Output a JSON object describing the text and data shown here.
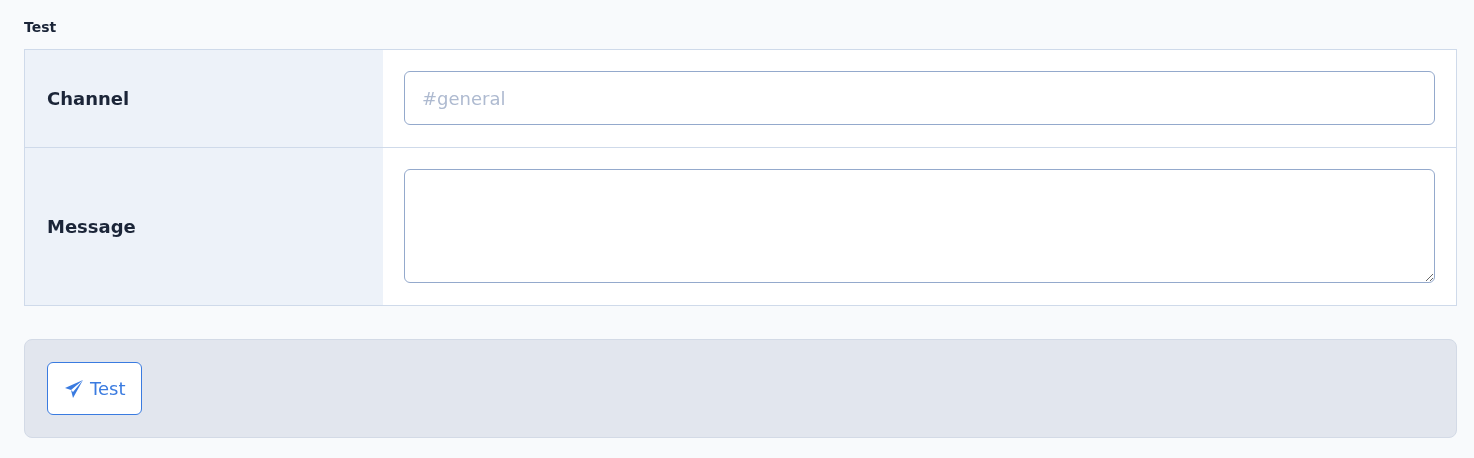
{
  "section_title": "Test",
  "fields": [
    {
      "label": "Channel",
      "kind": "input",
      "placeholder": "#general"
    },
    {
      "label": "Message",
      "kind": "textarea"
    }
  ],
  "actions": [
    {
      "label": "Test"
    }
  ]
}
